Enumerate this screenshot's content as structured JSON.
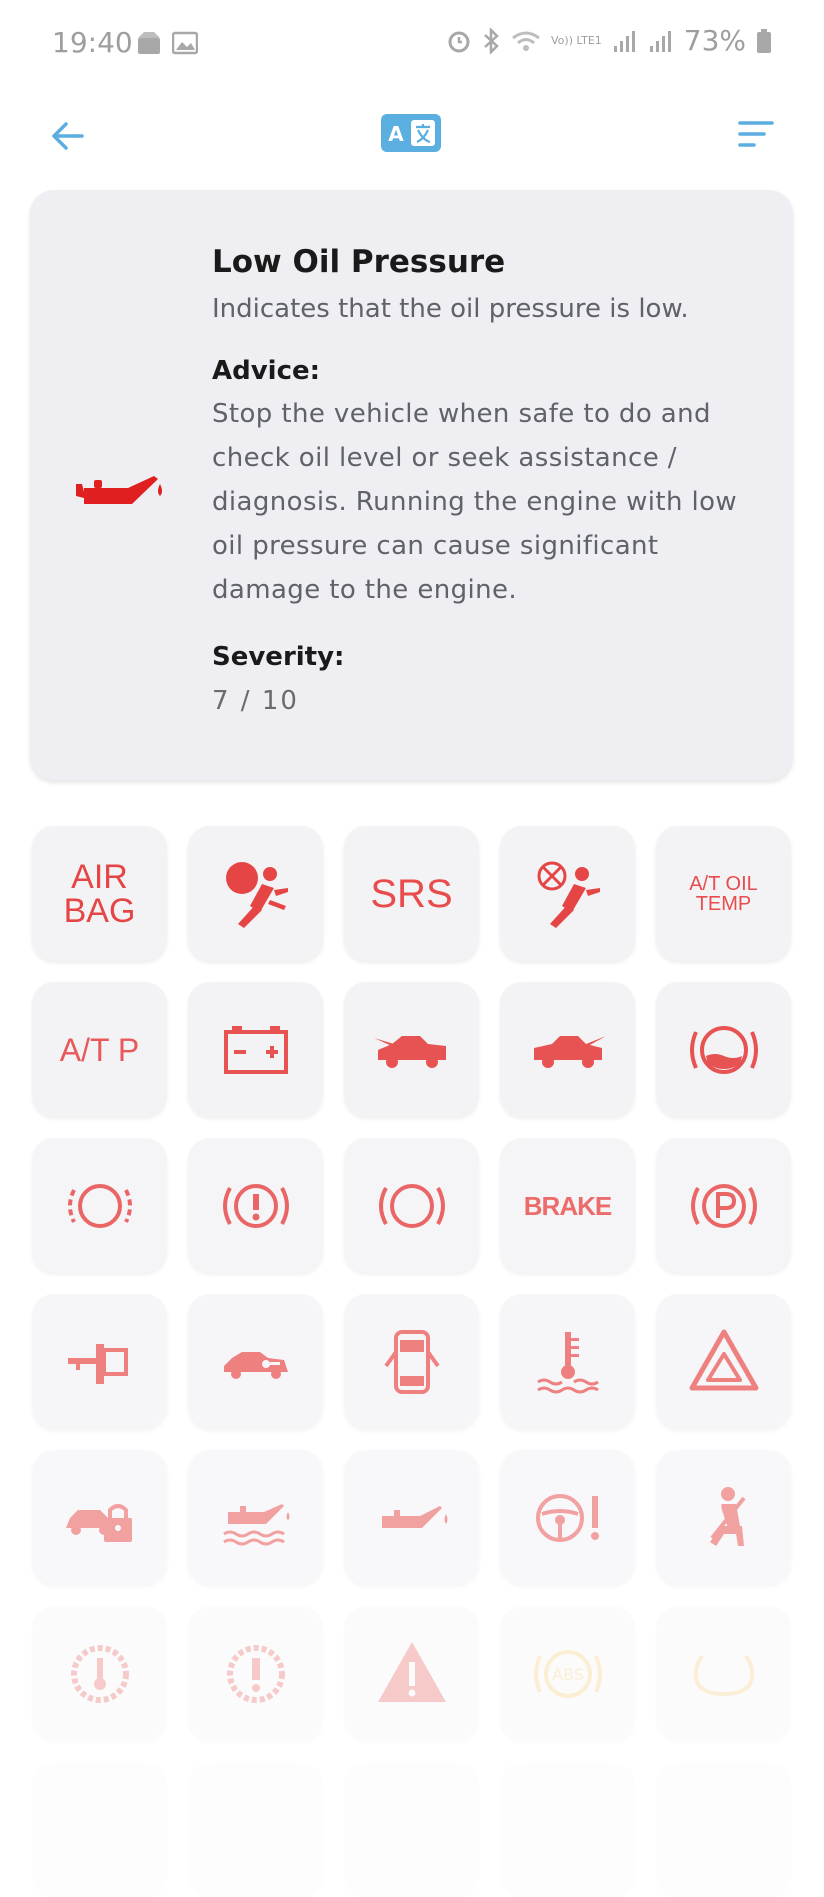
{
  "status_bar": {
    "time": "19:40",
    "network_label": "Vo)) LTE1",
    "battery": "73%"
  },
  "app_bar": {
    "back_icon": "arrow-left-icon",
    "translate_icon": "translate-icon",
    "menu_icon": "sort-menu-icon",
    "accent_color": "#5aaee0"
  },
  "detail": {
    "title": "Low Oil Pressure",
    "description": "Indicates that the oil pressure is low.",
    "advice_label": "Advice:",
    "advice_text": "Stop the vehicle when safe to do and check oil level or seek assistance / diagnosis. Running the engine with low oil pressure can cause significant damage to the engine.",
    "severity_label": "Severity:",
    "severity_value": "7 / 10",
    "icon": "oil-can-icon",
    "icon_color": "#e02020"
  },
  "warning_lights": [
    {
      "label": "AIR BAG",
      "icon": "airbag-text"
    },
    {
      "icon": "airbag-icon"
    },
    {
      "label": "SRS",
      "icon": "srs-text"
    },
    {
      "icon": "airbag-off-icon"
    },
    {
      "label": "A/T OIL TEMP",
      "icon": "at-oil-temp-text"
    },
    {
      "label": "A/T P",
      "icon": "at-p-text"
    },
    {
      "icon": "battery-icon"
    },
    {
      "icon": "car-hood-open-icon"
    },
    {
      "icon": "car-trunk-open-icon"
    },
    {
      "icon": "washer-fluid-icon"
    },
    {
      "icon": "brake-pad-icon"
    },
    {
      "icon": "brake-warning-icon"
    },
    {
      "icon": "brake-circle-icon"
    },
    {
      "label": "BRAKE",
      "icon": "brake-text"
    },
    {
      "icon": "parking-brake-icon"
    },
    {
      "icon": "key-icon"
    },
    {
      "icon": "car-key-icon"
    },
    {
      "icon": "door-open-icon"
    },
    {
      "icon": "coolant-temp-icon"
    },
    {
      "icon": "hazard-triangle-icon"
    },
    {
      "icon": "car-lock-icon"
    },
    {
      "icon": "oil-level-icon"
    },
    {
      "icon": "oil-pressure-icon"
    },
    {
      "icon": "steering-warning-icon"
    },
    {
      "icon": "seatbelt-icon"
    },
    {
      "icon": "gear-temp-icon"
    },
    {
      "icon": "gear-warning-icon"
    },
    {
      "icon": "warning-triangle-icon"
    },
    {
      "label": "ABS",
      "icon": "abs-icon",
      "color": "#f3c46a"
    },
    {
      "icon": "tpms-icon",
      "color": "#f3c46a"
    }
  ]
}
